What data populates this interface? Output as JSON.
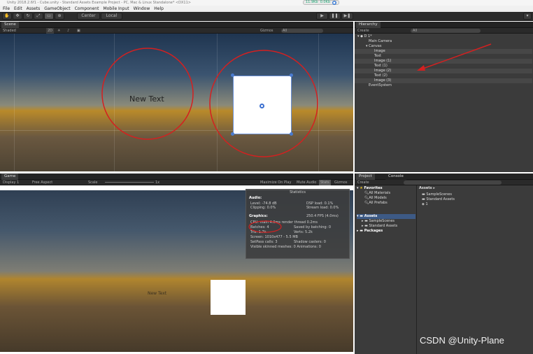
{
  "title": "Unity 2018.2.6f1 - Cube.unity - Standard Assets Example Project - PC, Mac & Linux Standalone* <DX11>",
  "status_badge": {
    "left": "11.9Kb",
    "right": "0.0Kb"
  },
  "menu": [
    "File",
    "Edit",
    "Assets",
    "GameObject",
    "Component",
    "Mobile Input",
    "Window",
    "Help"
  ],
  "toolbar": {
    "pivot": "Center",
    "space": "Local"
  },
  "scene": {
    "tab": "Scene",
    "shading": "Shaded",
    "mode_2d": "2D",
    "gizmos": "Gizmos",
    "search": "All",
    "new_text": "New Text"
  },
  "hierarchy": {
    "tab": "Hierarchy",
    "create": "Create",
    "search": "All",
    "scene": "D 1*",
    "items": [
      "Main Camera",
      "Canvas",
      "Image",
      "Text",
      "Image (1)",
      "Text (1)",
      "Image (2)",
      "Text (2)",
      "Image (3)",
      "EventSystem"
    ]
  },
  "game": {
    "tab": "Game",
    "display": "Display 1",
    "aspect": "Free Aspect",
    "scale_label": "Scale",
    "scale_value": "1x",
    "maximize": "Maximize On Play",
    "mute": "Mute Audio",
    "stats": "Stats",
    "gizmos": "Gizmos",
    "new_text": "New Text"
  },
  "statistics": {
    "title": "Statistics",
    "audio_h": "Audio:",
    "level": "Level: -74.8 dB",
    "dsp": "DSP load: 0.1%",
    "clipping": "Clipping: 0.0%",
    "stream": "Stream load: 0.0%",
    "graphics_h": "Graphics:",
    "fps": "250.4 FPS (4.0ms)",
    "cpu": "CPU: main 4.0ms  render thread 0.2ms",
    "batches": "Batches: 4",
    "saved": "Saved by batching: 0",
    "tris": "Tris: 1.7k",
    "verts": "Verts: 5.2k",
    "screen": "Screen: 1010x477 - 5.5 MB",
    "setpass": "SetPass calls: 3",
    "shadow": "Shadow casters: 0",
    "skinned": "Visible skinned meshes: 0  Animations: 0"
  },
  "project": {
    "tab": "Project",
    "console_tab": "Console",
    "create": "Create",
    "favorites": "Favorites",
    "fav_items": [
      "All Materials",
      "All Models",
      "All Prefabs"
    ],
    "assets": "Assets",
    "asset_folders": [
      "SampleScenes",
      "Standard Assets"
    ],
    "packages": "Packages",
    "breadcrumb": "Assets",
    "content": [
      "SampleScenes",
      "Standard Assets",
      "1"
    ]
  },
  "watermark": "CSDN @Unity-Plane",
  "colors": {
    "annotation": "#d42020",
    "selection": "#4a7bd0"
  }
}
